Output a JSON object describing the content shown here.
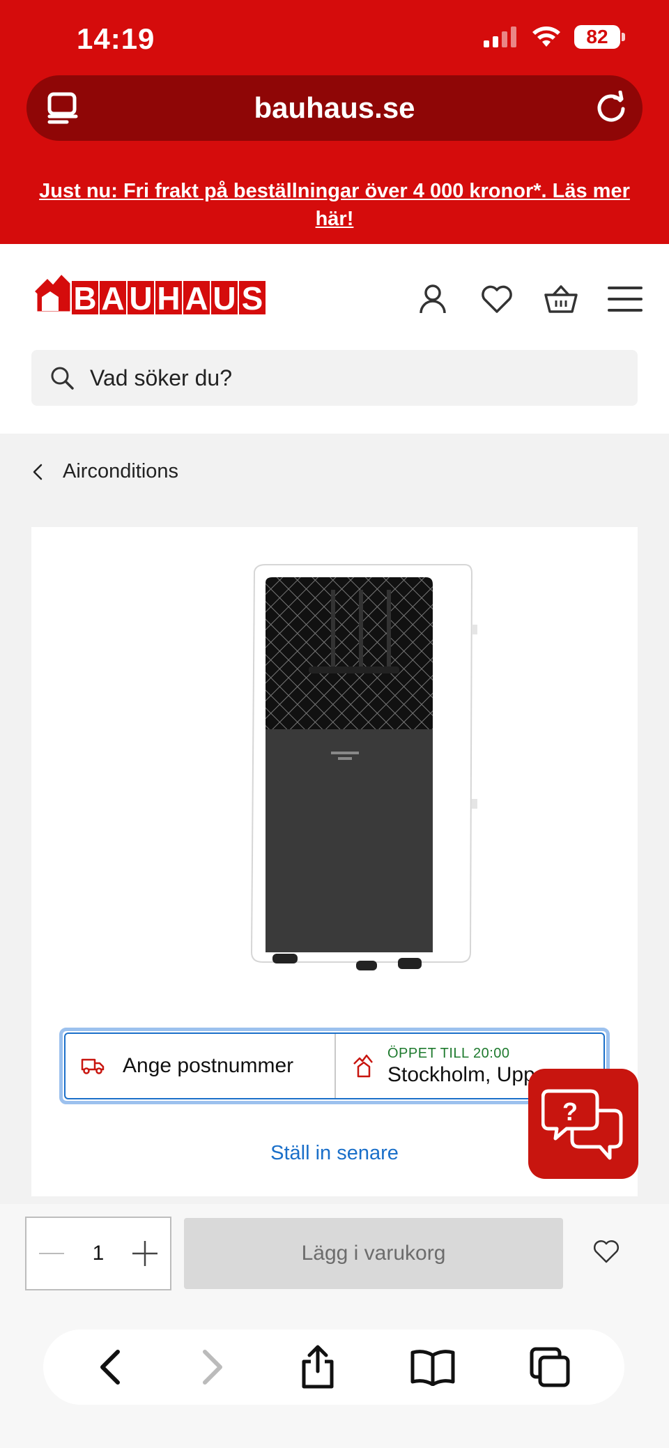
{
  "status_bar": {
    "time": "14:19",
    "battery": "82"
  },
  "browser": {
    "url": "bauhaus.se"
  },
  "promo": {
    "text": "Just nu: Fri frakt på beställningar över 4 000 kronor*. Läs mer här!"
  },
  "header": {
    "logo_text": "BAUHAUS",
    "search_placeholder": "Vad söker du?"
  },
  "breadcrumb": {
    "label": "Airconditions"
  },
  "delivery": {
    "postcode_label": "Ange postnummer",
    "open_label": "ÖPPET TILL 20:00",
    "store_name": "Stockholm, Upp"
  },
  "set_later": "Ställ in senare",
  "cart": {
    "quantity": "1",
    "add_label": "Lägg i varukorg"
  },
  "colors": {
    "brand_red": "#d50c0c",
    "dark_red": "#8f0606",
    "link_blue": "#1a6fc9",
    "open_green": "#1e7a2e"
  }
}
